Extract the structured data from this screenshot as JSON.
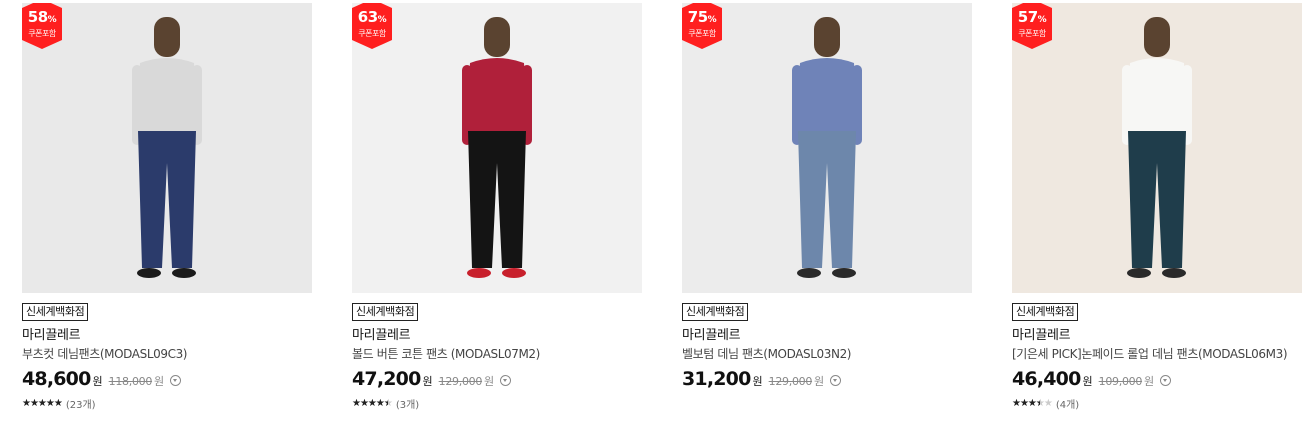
{
  "currency": "원",
  "products": [
    {
      "discount": "58",
      "percent_sign": "%",
      "coupon_label": "쿠폰포함",
      "store": "신세계백화점",
      "brand": "마리끌레르",
      "name": "부츠컷 데님팬츠(MODASL09C3)",
      "price": "48,600",
      "original_price": "118,000",
      "rating_fraction": 1.0,
      "review_count": "(23개)",
      "image": {
        "bg": "#e9e9e9",
        "top": "#d9d9d9",
        "pants": "#2b3b6b",
        "shoes": "#1b1b1b"
      }
    },
    {
      "discount": "63",
      "percent_sign": "%",
      "coupon_label": "쿠폰포함",
      "store": "신세계백화점",
      "brand": "마리끌레르",
      "name": "볼드 버튼 코튼 팬츠 (MODASL07M2)",
      "price": "47,200",
      "original_price": "129,000",
      "rating_fraction": 0.9,
      "review_count": "(3개)",
      "image": {
        "bg": "#f1f1f1",
        "top": "#b0203a",
        "pants": "#141414",
        "shoes": "#c8202c"
      }
    },
    {
      "discount": "75",
      "percent_sign": "%",
      "coupon_label": "쿠폰포함",
      "store": "신세계백화점",
      "brand": "마리끌레르",
      "name": "벨보텀 데님 팬츠(MODASL03N2)",
      "price": "31,200",
      "original_price": "129,000",
      "rating_fraction": 0,
      "review_count": "",
      "image": {
        "bg": "#ececec",
        "top": "#6f83b8",
        "pants": "#6d87ab",
        "shoes": "#2a2a2a"
      }
    },
    {
      "discount": "57",
      "percent_sign": "%",
      "coupon_label": "쿠폰포함",
      "store": "신세계백화점",
      "brand": "마리끌레르",
      "name": "[기은세 PICK]논페이드 롤업 데님 팬츠(MODASL06M3)",
      "price": "46,400",
      "original_price": "109,000",
      "rating_fraction": 0.7,
      "review_count": "(4개)",
      "image": {
        "bg": "#efe8e0",
        "top": "#f7f7f5",
        "pants": "#1f3d4b",
        "shoes": "#2a2a2a"
      }
    }
  ]
}
